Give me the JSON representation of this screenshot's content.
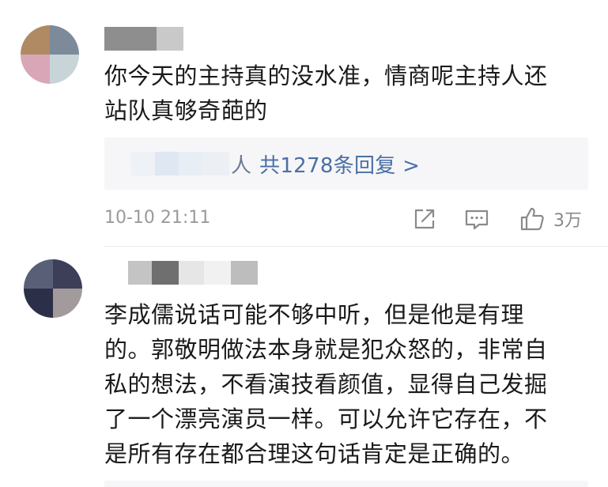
{
  "comments": [
    {
      "text": "你今天的主持真的没水准，情商呢主持人还\n站队真够奇葩的",
      "reply_summary": {
        "person_suffix": "人",
        "count_label": "共1278条回复 >"
      },
      "timestamp": "10-10 21:11",
      "likes": "3万",
      "avatar_colors": [
        "#b08a63",
        "#7c8a9a",
        "#d9a6b8",
        "#c7d4d8"
      ]
    },
    {
      "text": "李成儒说话可能不够中听，但是他是有理\n的。郭敬明做法本身就是犯众怒的，非常自\n私的想法，不看演技看颜值，显得自己发掘\n了一个漂亮演员一样。可以允许它存在，不\n是所有存在都合理这句话肯定是正确的。",
      "avatar_colors": [
        "#5a5f78",
        "#3d3f58",
        "#2c2f48",
        "#a39a9c"
      ]
    }
  ],
  "icons": {
    "share": "share-icon",
    "comment": "comment-icon",
    "like": "like-icon"
  },
  "colors": {
    "link_blue": "#4a6fa5",
    "meta_gray": "#9a9a9a",
    "reply_bg": "#f6f6f8"
  }
}
